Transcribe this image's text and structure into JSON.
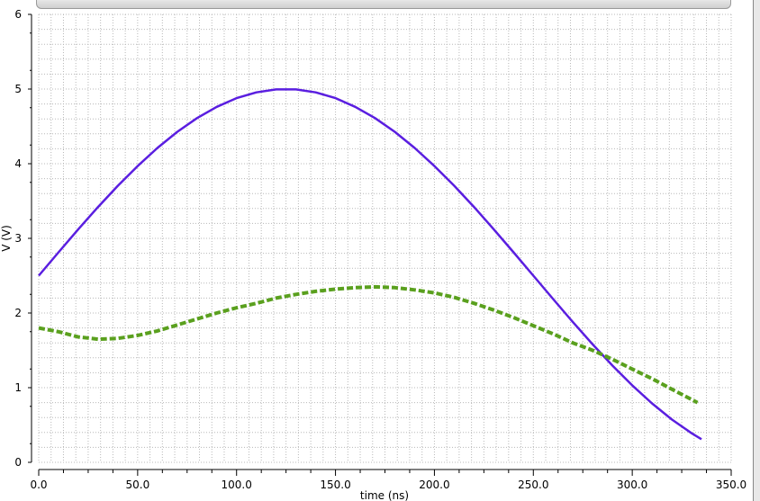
{
  "chart_data": {
    "type": "line",
    "title": "",
    "xlabel": "time (ns)",
    "ylabel": "V (V)",
    "xlim": [
      0,
      350
    ],
    "ylim": [
      0,
      6
    ],
    "grid": true,
    "x_ticks": [
      "0.0",
      "50.0",
      "100.0",
      "150.0",
      "200.0",
      "250.0",
      "300.0",
      "350.0"
    ],
    "y_ticks": [
      "0",
      "1",
      "2",
      "3",
      "4",
      "5",
      "6"
    ],
    "series": [
      {
        "name": "blue",
        "color": "#5a1ee0",
        "style": "solid",
        "x": [
          0,
          10,
          20,
          30,
          40,
          50,
          60,
          70,
          80,
          90,
          100,
          110,
          120,
          130,
          140,
          150,
          160,
          170,
          180,
          190,
          200,
          210,
          220,
          230,
          240,
          250,
          260,
          270,
          280,
          290,
          300,
          310,
          320,
          330,
          335
        ],
        "y": [
          2.5,
          2.813,
          3.122,
          3.42,
          3.705,
          3.969,
          4.211,
          4.426,
          4.611,
          4.762,
          4.878,
          4.956,
          4.995,
          4.995,
          4.956,
          4.878,
          4.762,
          4.611,
          4.426,
          4.211,
          3.969,
          3.705,
          3.42,
          3.122,
          2.813,
          2.5,
          2.187,
          1.878,
          1.58,
          1.295,
          1.031,
          0.789,
          0.574,
          0.389,
          0.31
        ]
      },
      {
        "name": "green",
        "color": "#5aa01e",
        "style": "dashed",
        "x": [
          0,
          10,
          20,
          30,
          40,
          50,
          60,
          70,
          80,
          90,
          100,
          110,
          120,
          130,
          140,
          150,
          160,
          170,
          180,
          190,
          200,
          210,
          220,
          230,
          240,
          250,
          260,
          270,
          280,
          290,
          300,
          310,
          320,
          333
        ],
        "y": [
          1.8,
          1.75,
          1.68,
          1.65,
          1.66,
          1.7,
          1.76,
          1.84,
          1.92,
          2.0,
          2.07,
          2.13,
          2.2,
          2.25,
          2.29,
          2.32,
          2.34,
          2.35,
          2.34,
          2.31,
          2.27,
          2.21,
          2.13,
          2.04,
          1.94,
          1.83,
          1.72,
          1.6,
          1.5,
          1.38,
          1.25,
          1.12,
          0.98,
          0.8
        ]
      }
    ]
  }
}
